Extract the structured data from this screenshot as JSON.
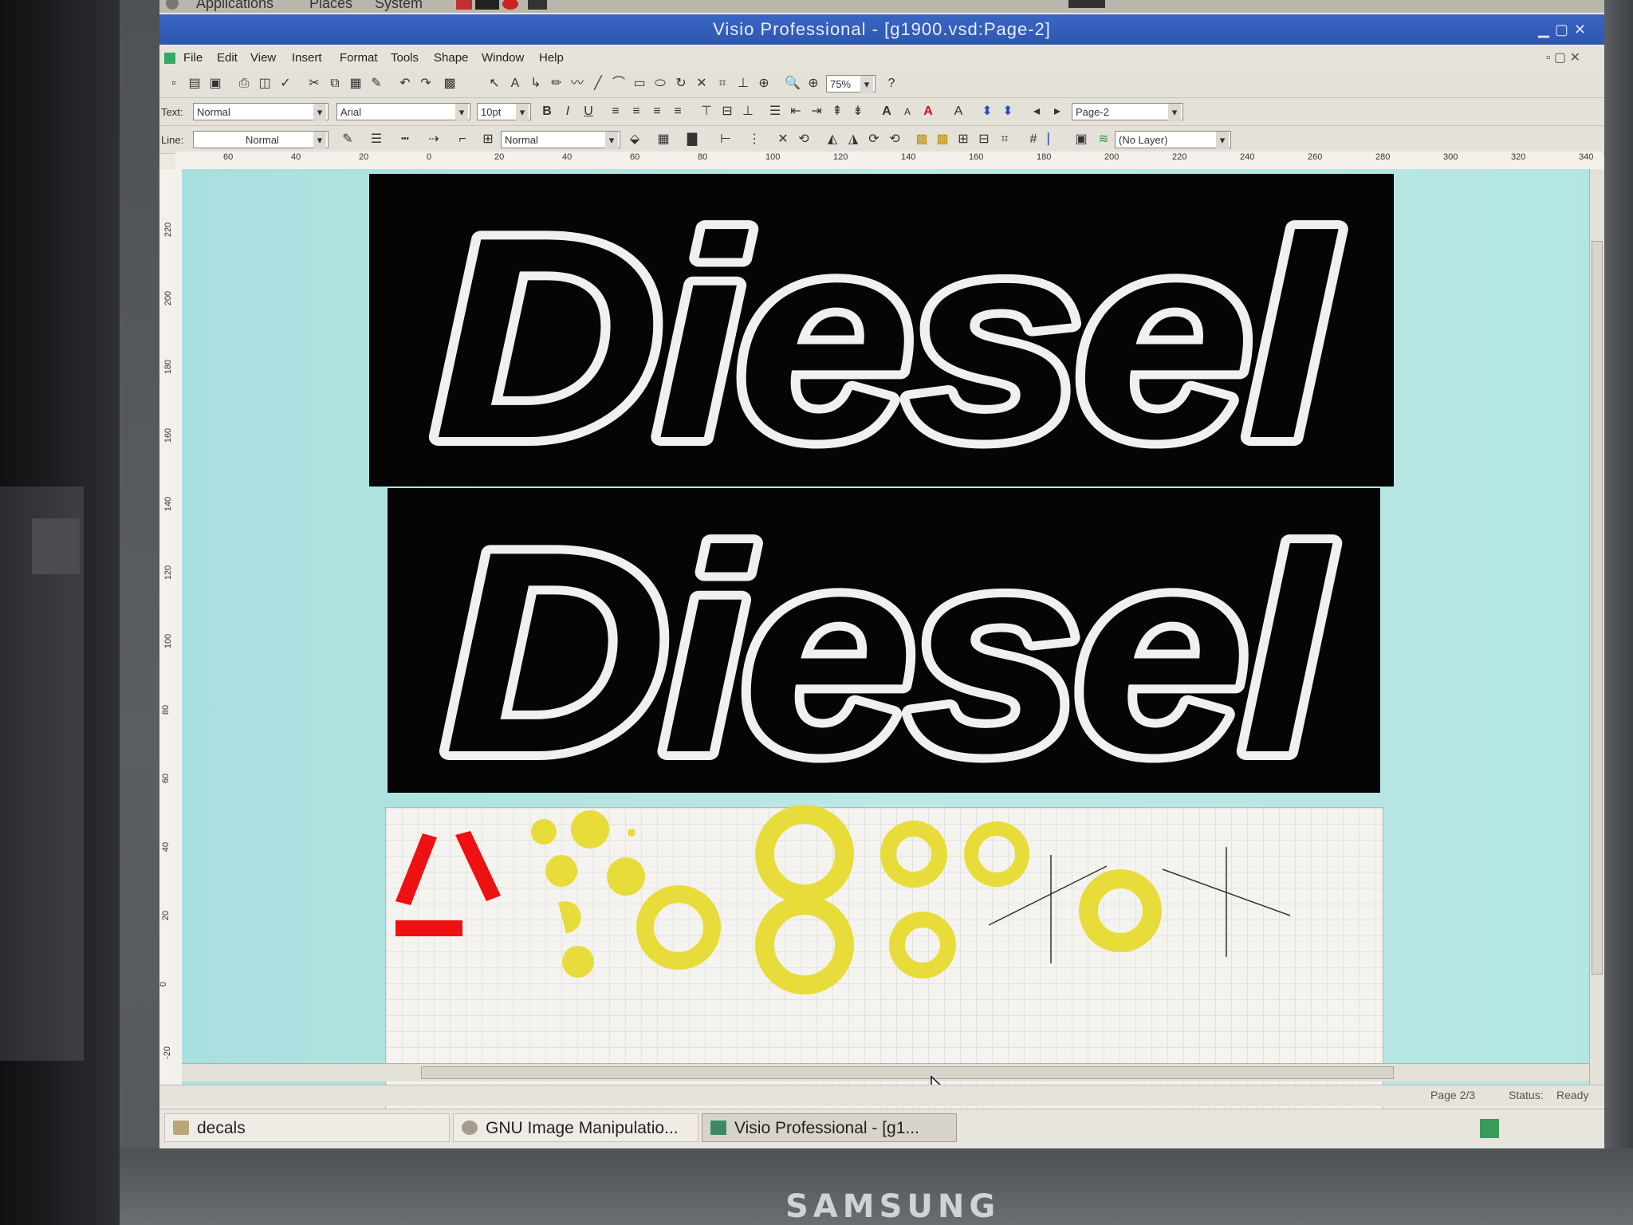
{
  "panel": {
    "applications": "Applications",
    "places": "Places",
    "system": "System"
  },
  "window": {
    "title": "Visio Professional - [g1900.vsd:Page-2]"
  },
  "menu": [
    "File",
    "Edit",
    "View",
    "Insert",
    "Format",
    "Tools",
    "Shape",
    "Window",
    "Help"
  ],
  "toolbar": {
    "zoom": "75%",
    "text_label": "Text:",
    "text_style": "Normal",
    "font": "Arial",
    "font_size": "10pt",
    "page_select": "Page-2",
    "line_label": "Line:",
    "line_style": "Normal",
    "fill_style": "Normal",
    "layer": "(No Layer)"
  },
  "ruler_h": [
    "60",
    "40",
    "20",
    "0",
    "20",
    "40",
    "60",
    "80",
    "100",
    "120",
    "140",
    "160",
    "180",
    "200",
    "220",
    "240",
    "260",
    "280",
    "300",
    "320",
    "340"
  ],
  "ruler_v": [
    "220",
    "200",
    "180",
    "160",
    "140",
    "120",
    "100",
    "80",
    "60",
    "40",
    "20",
    "0",
    "-20"
  ],
  "drawing": {
    "decal_text_top": "Diesel",
    "decal_text_bottom": "Diesel",
    "colors": {
      "decal_bg": "#050505",
      "decal_outline": "#f0f0f0",
      "red_marks": "#ee1111",
      "yellow_shapes": "#e8dc3a",
      "canvas": "#b3e6e3"
    }
  },
  "status": {
    "page": "Page 2/3",
    "status_label": "Status:",
    "status_value": "Ready"
  },
  "taskbar": [
    {
      "label": "decals",
      "icon": "folder-icon"
    },
    {
      "label": "GNU Image Manipulatio...",
      "icon": "gimp-icon"
    },
    {
      "label": "Visio Professional - [g1...",
      "icon": "visio-icon"
    }
  ],
  "monitor": {
    "brand": "SAMSUNG"
  }
}
